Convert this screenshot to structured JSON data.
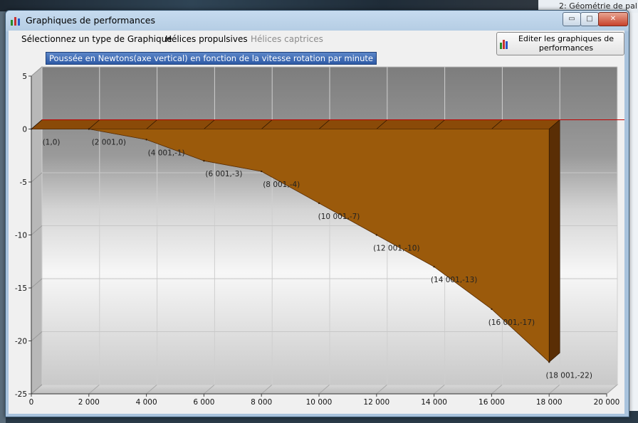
{
  "background": {
    "tree_item": "2: Géométrie de pal"
  },
  "window": {
    "title": "Graphiques de performances",
    "controls": {
      "minimize": "▭",
      "maximize": "□",
      "close": "✕"
    }
  },
  "menu": {
    "items": [
      {
        "label": "Sélectionnez un type de Graphique",
        "enabled": true
      },
      {
        "label": "Hélices propulsives",
        "enabled": true
      },
      {
        "label": "Hélices captrices",
        "enabled": false
      }
    ],
    "edit_button": "Editer les graphiques de performances"
  },
  "colors": {
    "area_fill": "#9b5a0b",
    "area_dark": "#5a2e05",
    "zero_line": "#c00000",
    "title_bg": "#2e5aa6"
  },
  "chart_data": {
    "type": "area",
    "title": "Poussée en Newtons(axe vertical) en fonction de la vitesse rotation par minute",
    "xlim": [
      0,
      20000
    ],
    "ylim": [
      -25,
      5
    ],
    "x_ticks": [
      "0",
      "2 000",
      "4 000",
      "6 000",
      "8 000",
      "10 000",
      "12 000",
      "14 000",
      "16 000",
      "18 000",
      "20 000"
    ],
    "y_ticks": [
      "5",
      "0",
      "-5",
      "-10",
      "-15",
      "-20",
      "-25"
    ],
    "grid": true,
    "three_d": true,
    "x": [
      1,
      2001,
      4001,
      6001,
      8001,
      10001,
      12001,
      14001,
      16001,
      18001
    ],
    "values": [
      0,
      0,
      -1,
      -3,
      -4,
      -7,
      -10,
      -13,
      -17,
      -22
    ],
    "point_labels": [
      "(1,0)",
      "(2 001,0)",
      "(4 001,-1)",
      "(6 001,-3)",
      "(8 001,-4)",
      "(10 001,-7)",
      "(12 001,-10)",
      "(14 001,-13)",
      "(16 001,-17)",
      "(18 001,-22)"
    ]
  }
}
